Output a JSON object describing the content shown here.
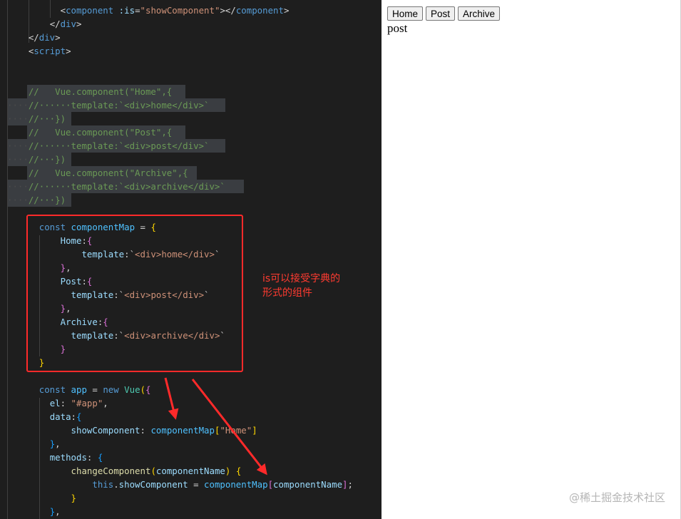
{
  "editor": {
    "code_lines": [
      [
        [
          "    ",
          "c-ws"
        ],
        [
          "    ",
          "c-ws"
        ],
        [
          "  ",
          "c-ws"
        ],
        [
          "<",
          "c-pun"
        ],
        [
          "component",
          "c-tag"
        ],
        [
          " :is",
          "c-attr"
        ],
        [
          "=",
          "c-pun"
        ],
        [
          "\"showComponent\"",
          "c-str"
        ],
        [
          "></",
          "c-pun"
        ],
        [
          "component",
          "c-tag"
        ],
        [
          ">",
          "c-pun"
        ]
      ],
      [
        [
          "    ",
          "c-ws"
        ],
        [
          "    ",
          "c-ws"
        ],
        [
          "</",
          "c-pun"
        ],
        [
          "div",
          "c-tag"
        ],
        [
          ">",
          "c-pun"
        ]
      ],
      [
        [
          "    ",
          "c-ws"
        ],
        [
          "</",
          "c-pun"
        ],
        [
          "div",
          "c-tag"
        ],
        [
          ">",
          "c-pun"
        ]
      ],
      [
        [
          "    ",
          "c-ws"
        ],
        [
          "<",
          "c-pun"
        ],
        [
          "script",
          "c-tag"
        ],
        [
          ">",
          "c-pun"
        ]
      ],
      [
        [
          "",
          ""
        ]
      ],
      [
        [
          "",
          ""
        ]
      ],
      [
        [
          "    ",
          "c-ws"
        ],
        [
          "//   Vue.component(\"Home\",{",
          "c-com"
        ]
      ],
      [
        [
          "····",
          "c-ws"
        ],
        [
          "//······template:`<div>home</div>`",
          "c-com"
        ]
      ],
      [
        [
          "····",
          "c-ws"
        ],
        [
          "//···})",
          "c-com"
        ]
      ],
      [
        [
          "    ",
          "c-ws"
        ],
        [
          "//   Vue.component(\"Post\",{",
          "c-com"
        ]
      ],
      [
        [
          "····",
          "c-ws"
        ],
        [
          "//······template:`<div>post</div>`",
          "c-com"
        ]
      ],
      [
        [
          "····",
          "c-ws"
        ],
        [
          "//···})",
          "c-com"
        ]
      ],
      [
        [
          "    ",
          "c-ws"
        ],
        [
          "//   Vue.component(\"Archive\",{",
          "c-com"
        ]
      ],
      [
        [
          "····",
          "c-ws"
        ],
        [
          "//······template:`<div>archive</div>`",
          "c-com"
        ]
      ],
      [
        [
          "····",
          "c-ws"
        ],
        [
          "//···})",
          "c-com"
        ]
      ],
      [
        [
          "",
          ""
        ]
      ],
      [
        [
          "      ",
          "c-ws"
        ],
        [
          "const ",
          "c-kw"
        ],
        [
          "componentMap",
          "c-var"
        ],
        [
          " = ",
          "c-pun"
        ],
        [
          "{",
          "c-br1"
        ]
      ],
      [
        [
          "          ",
          "c-ws"
        ],
        [
          "Home",
          "c-prop"
        ],
        [
          ":",
          "c-pun"
        ],
        [
          "{",
          "c-br2"
        ]
      ],
      [
        [
          "              ",
          "c-ws"
        ],
        [
          "template",
          "c-prop"
        ],
        [
          ":`",
          "c-pun"
        ],
        [
          "<div>home</div>",
          "c-str"
        ],
        [
          "`",
          "c-pun"
        ]
      ],
      [
        [
          "          ",
          "c-ws"
        ],
        [
          "}",
          "c-br2"
        ],
        [
          ",",
          "c-pun"
        ]
      ],
      [
        [
          "          ",
          "c-ws"
        ],
        [
          "Post",
          "c-prop"
        ],
        [
          ":",
          "c-pun"
        ],
        [
          "{",
          "c-br2"
        ]
      ],
      [
        [
          "            ",
          "c-ws"
        ],
        [
          "template",
          "c-prop"
        ],
        [
          ":`",
          "c-pun"
        ],
        [
          "<div>post</div>",
          "c-str"
        ],
        [
          "`",
          "c-pun"
        ]
      ],
      [
        [
          "          ",
          "c-ws"
        ],
        [
          "}",
          "c-br2"
        ],
        [
          ",",
          "c-pun"
        ]
      ],
      [
        [
          "          ",
          "c-ws"
        ],
        [
          "Archive",
          "c-prop"
        ],
        [
          ":",
          "c-pun"
        ],
        [
          "{",
          "c-br2"
        ]
      ],
      [
        [
          "            ",
          "c-ws"
        ],
        [
          "template",
          "c-prop"
        ],
        [
          ":`",
          "c-pun"
        ],
        [
          "<div>archive</div>",
          "c-str"
        ],
        [
          "`",
          "c-pun"
        ]
      ],
      [
        [
          "          ",
          "c-ws"
        ],
        [
          "}",
          "c-br2"
        ]
      ],
      [
        [
          "      ",
          "c-ws"
        ],
        [
          "}",
          "c-br1"
        ]
      ],
      [
        [
          "",
          ""
        ]
      ],
      [
        [
          "      ",
          "c-ws"
        ],
        [
          "const ",
          "c-kw"
        ],
        [
          "app",
          "c-var"
        ],
        [
          " = ",
          "c-pun"
        ],
        [
          "new ",
          "c-kw"
        ],
        [
          "Vue",
          "c-cls"
        ],
        [
          "(",
          "c-br1"
        ],
        [
          "{",
          "c-br2"
        ]
      ],
      [
        [
          "        ",
          "c-ws"
        ],
        [
          "el",
          "c-prop"
        ],
        [
          ": ",
          "c-pun"
        ],
        [
          "\"#app\"",
          "c-str"
        ],
        [
          ",",
          "c-pun"
        ]
      ],
      [
        [
          "        ",
          "c-ws"
        ],
        [
          "data",
          "c-prop"
        ],
        [
          ":",
          "c-pun"
        ],
        [
          "{",
          "c-br3"
        ]
      ],
      [
        [
          "            ",
          "c-ws"
        ],
        [
          "showComponent",
          "c-prop"
        ],
        [
          ": ",
          "c-pun"
        ],
        [
          "componentMap",
          "c-var"
        ],
        [
          "[",
          "c-br1"
        ],
        [
          "\"Home\"",
          "c-str"
        ],
        [
          "]",
          "c-br1"
        ]
      ],
      [
        [
          "        ",
          "c-ws"
        ],
        [
          "}",
          "c-br3"
        ],
        [
          ",",
          "c-pun"
        ]
      ],
      [
        [
          "        ",
          "c-ws"
        ],
        [
          "methods",
          "c-prop"
        ],
        [
          ": ",
          "c-pun"
        ],
        [
          "{",
          "c-br3"
        ]
      ],
      [
        [
          "            ",
          "c-ws"
        ],
        [
          "changeComponent",
          "c-fn"
        ],
        [
          "(",
          "c-br1"
        ],
        [
          "componentName",
          "c-prop"
        ],
        [
          ") ",
          "c-br1"
        ],
        [
          "{",
          "c-br1"
        ]
      ],
      [
        [
          "                ",
          "c-ws"
        ],
        [
          "this",
          "c-kw"
        ],
        [
          ".",
          "c-pun"
        ],
        [
          "showComponent",
          "c-prop"
        ],
        [
          " = ",
          "c-pun"
        ],
        [
          "componentMap",
          "c-var"
        ],
        [
          "[",
          "c-br2"
        ],
        [
          "componentName",
          "c-prop"
        ],
        [
          "]",
          "c-br2"
        ],
        [
          ";",
          "c-pun"
        ]
      ],
      [
        [
          "            ",
          "c-ws"
        ],
        [
          "}",
          "c-br1"
        ]
      ],
      [
        [
          "        ",
          "c-ws"
        ],
        [
          "}",
          "c-br3"
        ],
        [
          ",",
          "c-pun"
        ]
      ]
    ],
    "annotation": "is可以接受字典的形式的组件"
  },
  "preview": {
    "buttons": [
      "Home",
      "Post",
      "Archive"
    ],
    "output": "post"
  },
  "watermark": "@稀土掘金技术社区",
  "colors": {
    "editor_bg": "#1e1e1e",
    "annotation_red": "#ff2a2a"
  }
}
